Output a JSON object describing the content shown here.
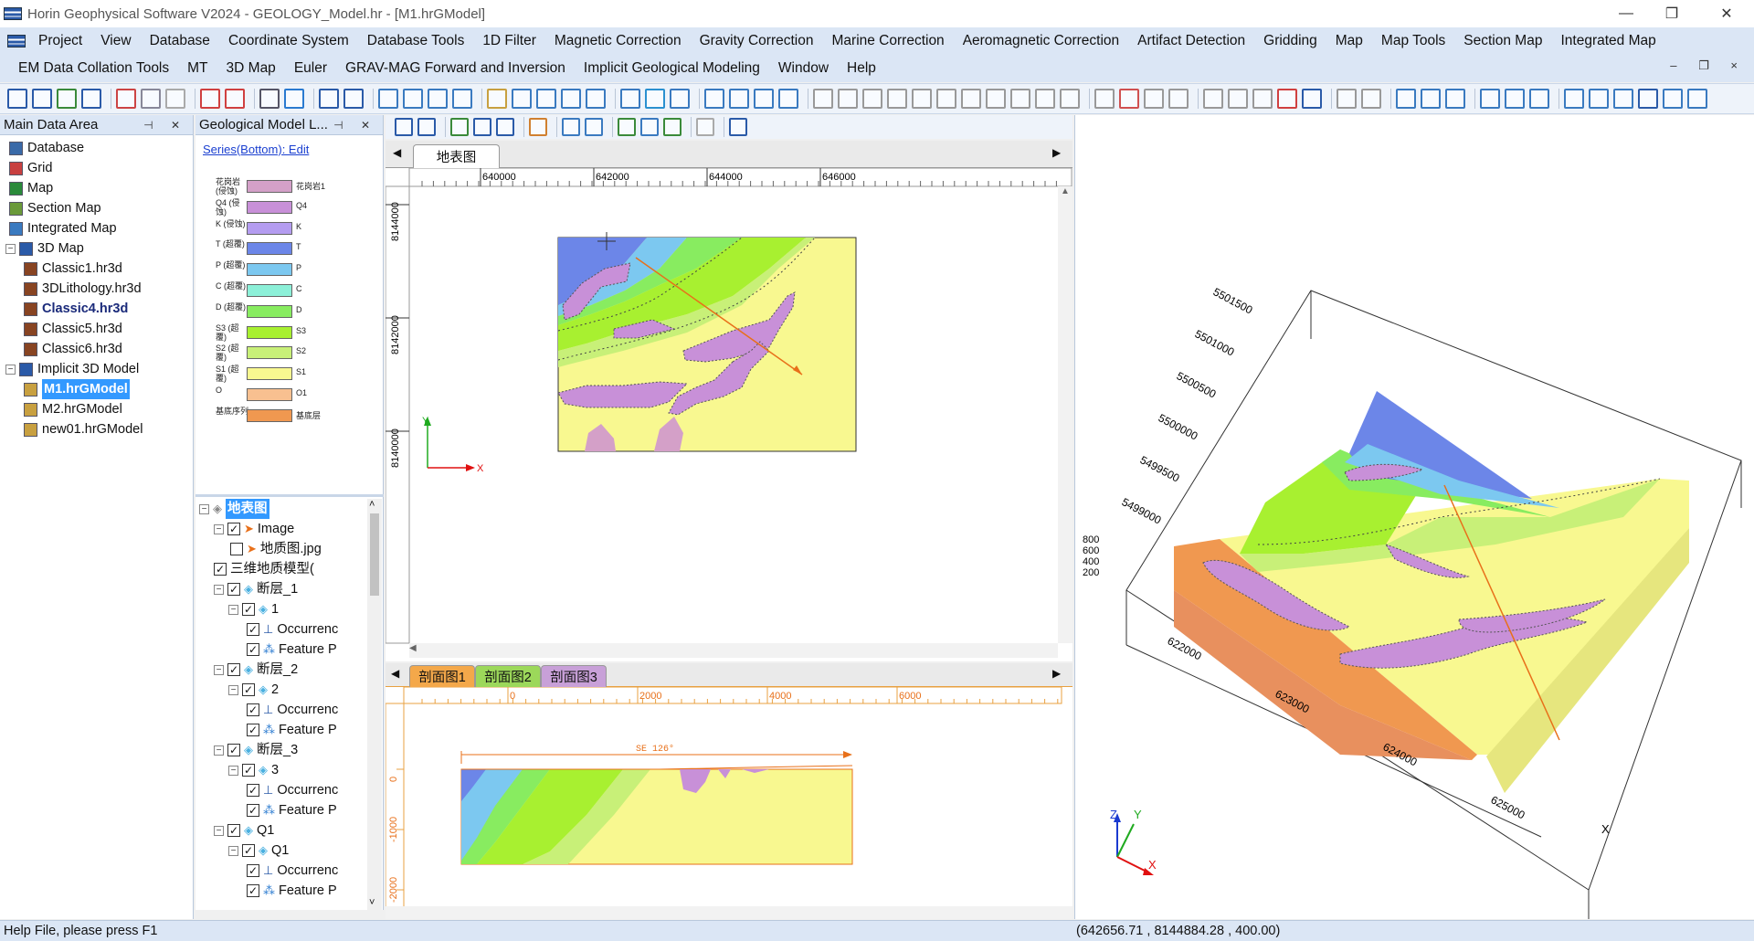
{
  "window": {
    "title": "Horin Geophysical Software V2024 - GEOLOGY_Model.hr - [M1.hrGModel]"
  },
  "menu1": [
    "Project",
    "View",
    "Database",
    "Coordinate System",
    "Database Tools",
    "1D Filter",
    "Magnetic Correction",
    "Gravity Correction",
    "Marine Correction",
    "Aeromagnetic Correction",
    "Artifact Detection",
    "Gridding",
    "Map",
    "Map Tools",
    "Section  Map",
    "Integrated Map"
  ],
  "menu2": [
    "EM Data Collation Tools",
    "MT",
    "3D Map",
    "Euler",
    "GRAV-MAG Forward and Inversion",
    "Implicit Geological Modeling",
    "Window",
    "Help"
  ],
  "main_data": {
    "title": "Main Data Area",
    "items": [
      "Database",
      "Grid",
      "Map",
      "Section Map",
      "Integrated Map",
      "3D Map",
      "Classic1.hr3d",
      "3DLithology.hr3d",
      "Classic4.hr3d",
      "Classic5.hr3d",
      "Classic6.hr3d",
      "Implicit 3D Model",
      "M1.hrGModel",
      "M2.hrGModel",
      "new01.hrGModel"
    ]
  },
  "geo_panel": {
    "title": "Geological Model L...",
    "series_link": "Series(Bottom): Edit",
    "legend": [
      {
        "left": "花岗岩 (侵蚀)",
        "right": "花岗岩1",
        "color": "#d4a0c8"
      },
      {
        "left": "Q4 (侵蚀)",
        "right": "Q4",
        "color": "#c890d8"
      },
      {
        "left": "K (侵蚀)",
        "right": "K",
        "color": "#b49cf0"
      },
      {
        "left": "T (超覆)",
        "right": "T",
        "color": "#6c86e8"
      },
      {
        "left": "P (超覆)",
        "right": "P",
        "color": "#7cc8f0"
      },
      {
        "left": "C (超覆)",
        "right": "C",
        "color": "#8cf0d8"
      },
      {
        "left": "D (超覆)",
        "right": "D",
        "color": "#88ec60"
      },
      {
        "left": "S3 (超覆)",
        "right": "S3",
        "color": "#a8f030"
      },
      {
        "left": "S2 (超覆)",
        "right": "S2",
        "color": "#c8f078"
      },
      {
        "left": "S1 (超覆)",
        "right": "S1",
        "color": "#f8f890"
      },
      {
        "left": "O",
        "right": "O1",
        "color": "#f8c090"
      },
      {
        "left": "基底序列",
        "right": "基底层",
        "color": "#f09850"
      }
    ],
    "tree": {
      "root": "地表图",
      "image": "Image",
      "jpg": "地质图.jpg",
      "model3d": "三维地质模型(",
      "groups": [
        {
          "name": "断层_1",
          "sub": "1"
        },
        {
          "name": "断层_2",
          "sub": "2"
        },
        {
          "name": "断层_3",
          "sub": "3"
        },
        {
          "name": "Q1",
          "sub": "Q1"
        }
      ],
      "occurrence": "Occurrenc",
      "feature": "Feature P"
    }
  },
  "map_view": {
    "tab": "地表图",
    "xticks": [
      "640000",
      "642000",
      "644000",
      "646000"
    ],
    "yticks": [
      "8144000",
      "8142000",
      "8140000"
    ],
    "axis_y": "Y",
    "axis_x": "X"
  },
  "section_view": {
    "tabs": [
      "剖面图1",
      "剖面图2",
      "剖面图3"
    ],
    "xticks": [
      "0",
      "2000",
      "4000",
      "6000"
    ],
    "yticks": [
      "0",
      "-1000",
      "-2000"
    ],
    "direction": "SE 126°"
  },
  "view3d": {
    "ylabels": [
      "5501500",
      "5501000",
      "5500500",
      "5500000",
      "5499500",
      "5499000"
    ],
    "xlabels": [
      "622000",
      "623000",
      "624000",
      "625000"
    ],
    "zlabels": [
      "800",
      "600",
      "400",
      "200"
    ],
    "axis_x": "X",
    "tri_z": "Z",
    "tri_y": "Y",
    "tri_x": "X"
  },
  "status": {
    "help": "Help File, please press F1",
    "coords": "(642656.71 , 8144884.28 , 400.00)"
  }
}
